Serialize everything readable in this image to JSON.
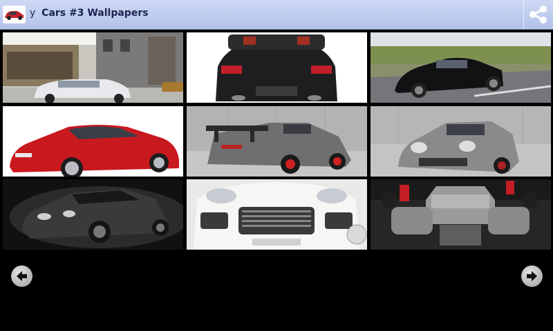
{
  "app": {
    "title_prefix": "y",
    "title": "Cars #3 Wallpapers",
    "icon": "red-car-app-icon"
  },
  "actions": {
    "share_icon": "share-icon"
  },
  "gallery": {
    "tiles": [
      {
        "name": "white-hatchback-street"
      },
      {
        "name": "black-convertible-rear"
      },
      {
        "name": "black-coupe-road"
      },
      {
        "name": "red-coupe"
      },
      {
        "name": "grey-sports-car-wing"
      },
      {
        "name": "grey-sports-car-front"
      },
      {
        "name": "dark-sports-car-studio"
      },
      {
        "name": "white-suv-front"
      },
      {
        "name": "turbo-engine"
      }
    ]
  },
  "nav": {
    "prev_icon": "arrow-left-icon",
    "next_icon": "arrow-right-icon"
  },
  "colors": {
    "actionbar": "#c5d2f0",
    "title": "#1b2450",
    "background": "#000000"
  }
}
